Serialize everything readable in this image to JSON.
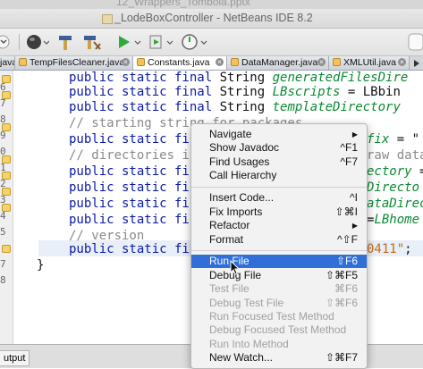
{
  "ghost_window_title": "12_Wrappers_Tombola.pptx",
  "window": {
    "title": "_LodeBoxController - NetBeans IDE 8.2"
  },
  "tabs": [
    {
      "label": "java",
      "active": false
    },
    {
      "label": "TempFilesCleaner.java",
      "active": false
    },
    {
      "label": "Constants.java",
      "active": true
    },
    {
      "label": "DataManager.java",
      "active": false
    },
    {
      "label": "XMLUtil.java",
      "active": false
    }
  ],
  "gutter_numbers": [
    "5",
    "6",
    "7",
    "8",
    "9",
    "0",
    "1",
    "2",
    "3",
    "4",
    "5",
    "6",
    "7",
    "8"
  ],
  "code": {
    "l1": {
      "kw": "public static final",
      "type": " String ",
      "field": "generatedFilesDire"
    },
    "l2": {
      "kw": "public static final",
      "type": " String ",
      "field": "LBscripts",
      "rest": " = LBbin"
    },
    "l3": {
      "kw": "public static final",
      "type": " String ",
      "field": "templateDirectory"
    },
    "l4": {
      "comment": "// starting string for packages"
    },
    "l5": {
      "kw": "public static fi",
      "field": "fix",
      "rest": " = \""
    },
    "l6": {
      "comment": "// directories i",
      "rest": "raw data"
    },
    "l7": {
      "kw": "public static fi",
      "field": "ectory",
      "rest": " ="
    },
    "l8": {
      "kw": "public static fi",
      "field": "Directo"
    },
    "l9": {
      "kw": "public static fi",
      "field": "ataDirec"
    },
    "l10": {
      "kw": "public static fi",
      "rest": "=",
      "field": "LBhome"
    },
    "l11": {
      "comment": "// version"
    },
    "l12": {
      "kw": "public static fi",
      "string": "0411\"",
      "rest": ";"
    },
    "l13": {
      "brace": "}"
    }
  },
  "context_menu": [
    {
      "label": "Navigate",
      "submenu": true
    },
    {
      "label": "Show Javadoc",
      "shortcut": "^F1"
    },
    {
      "label": "Find Usages",
      "shortcut": "^F7"
    },
    {
      "label": "Call Hierarchy"
    },
    {
      "separator": true
    },
    {
      "label": "Insert Code...",
      "shortcut": "^I"
    },
    {
      "label": "Fix Imports",
      "shortcut": "⇧⌘I"
    },
    {
      "label": "Refactor",
      "submenu": true
    },
    {
      "label": "Format",
      "shortcut": "^⇧F"
    },
    {
      "separator": true
    },
    {
      "label": "Run File",
      "shortcut": "⇧F6",
      "selected": true
    },
    {
      "label": "Debug File",
      "shortcut": "⇧⌘F5"
    },
    {
      "label": "Test File",
      "shortcut": "⌘F6",
      "disabled": true
    },
    {
      "label": "Debug Test File",
      "shortcut": "⇧⌘F6",
      "disabled": true
    },
    {
      "label": "Run Focused Test Method",
      "disabled": true
    },
    {
      "label": "Debug Focused Test Method",
      "disabled": true
    },
    {
      "label": "Run Into Method",
      "disabled": true
    },
    {
      "label": "New Watch...",
      "shortcut": "⇧⌘F7"
    }
  ],
  "bottom_panel": {
    "tab_label": "utput"
  }
}
